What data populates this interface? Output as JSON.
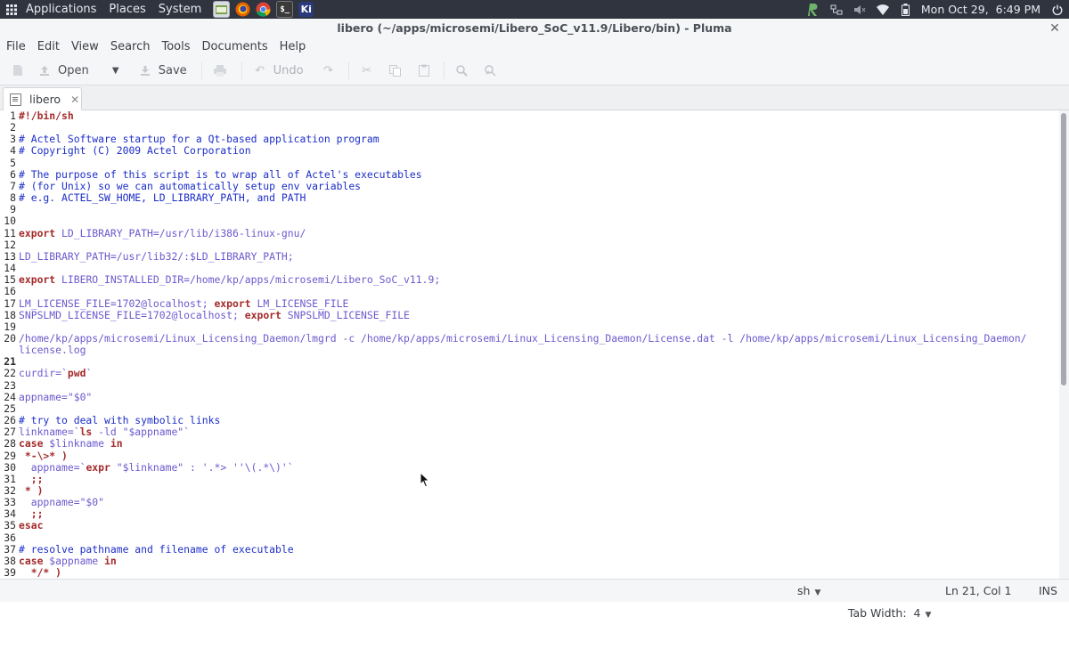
{
  "panel": {
    "menus": [
      "Applications",
      "Places",
      "System"
    ],
    "launchers": [
      "file-manager",
      "firefox",
      "chrome",
      "terminal",
      "kicad"
    ],
    "clock": "Mon Oct 29,  6:49 PM"
  },
  "window": {
    "title": "libero (~/apps/microsemi/Libero_SoC_v11.9/Libero/bin) - Pluma"
  },
  "menubar": [
    "File",
    "Edit",
    "View",
    "Search",
    "Tools",
    "Documents",
    "Help"
  ],
  "toolbar": {
    "open_label": "Open",
    "save_label": "Save",
    "undo_label": "Undo"
  },
  "tab": {
    "label": "libero"
  },
  "editor": {
    "lines": [
      {
        "n": "1",
        "text": "#!/bin/sh",
        "style": "bold"
      },
      {
        "n": "2",
        "text": "",
        "style": "plain"
      },
      {
        "n": "3",
        "text": "# Actel Software startup for a Qt-based application program",
        "style": "comment"
      },
      {
        "n": "4",
        "text": "# Copyright (C) 2009 Actel Corporation",
        "style": "comment"
      },
      {
        "n": "5",
        "text": "",
        "style": "plain"
      },
      {
        "n": "6",
        "text": "# The purpose of this script is to wrap all of Actel's executables",
        "style": "comment"
      },
      {
        "n": "7",
        "text": "# (for Unix) so we can automatically setup env variables",
        "style": "comment"
      },
      {
        "n": "8",
        "text": "# e.g. ACTEL_SW_HOME, LD_LIBRARY_PATH, and PATH",
        "style": "comment"
      },
      {
        "n": "9",
        "text": "",
        "style": "plain"
      },
      {
        "n": "10",
        "text": "",
        "style": "plain"
      },
      {
        "n": "11",
        "text": "export LD_LIBRARY_PATH=/usr/lib/i386-linux-gnu/",
        "style": "export"
      },
      {
        "n": "12",
        "text": "",
        "style": "plain"
      },
      {
        "n": "13",
        "text": "LD_LIBRARY_PATH=/usr/lib32/:$LD_LIBRARY_PATH;",
        "style": "purple"
      },
      {
        "n": "14",
        "text": "",
        "style": "plain"
      },
      {
        "n": "15",
        "text": "export LIBERO_INSTALLED_DIR=/home/kp/apps/microsemi/Libero_SoC_v11.9;",
        "style": "export"
      },
      {
        "n": "16",
        "text": "",
        "style": "plain"
      },
      {
        "n": "17",
        "text": "LM_LICENSE_FILE=1702@localhost; export LM_LICENSE_FILE",
        "style": "purple"
      },
      {
        "n": "18",
        "text": "SNPSLMD_LICENSE_FILE=1702@localhost; export SNPSLMD_LICENSE_FILE",
        "style": "purple"
      },
      {
        "n": "19",
        "text": "",
        "style": "plain"
      },
      {
        "n": "20",
        "text": "/home/kp/apps/microsemi/Linux_Licensing_Daemon/lmgrd -c /home/kp/apps/microsemi/Linux_Licensing_Daemon/License.dat -l /home/kp/apps/microsemi/Linux_Licensing_Daemon/",
        "style": "purple"
      },
      {
        "n": "",
        "text": "license.log",
        "style": "purple"
      },
      {
        "n": "21",
        "text": "",
        "style": "current"
      },
      {
        "n": "22",
        "text": "curdir=`pwd`",
        "style": "purple"
      },
      {
        "n": "23",
        "text": "",
        "style": "plain"
      },
      {
        "n": "24",
        "text": "appname=\"$0\"",
        "style": "purple"
      },
      {
        "n": "25",
        "text": "",
        "style": "plain"
      },
      {
        "n": "26",
        "text": "# try to deal with symbolic links",
        "style": "comment"
      },
      {
        "n": "27",
        "text": "linkname=`ls -ld \"$appname\"`",
        "style": "purple"
      },
      {
        "n": "28",
        "text": "case $linkname in",
        "style": "purple"
      },
      {
        "n": "29",
        "text": " *-\\>* )",
        "style": "bold"
      },
      {
        "n": "30",
        "text": "  appname=`expr \"$linkname\" : '.*> ''\\(.*\\)'`",
        "style": "purple"
      },
      {
        "n": "31",
        "text": "  ;;",
        "style": "bold"
      },
      {
        "n": "32",
        "text": " * )",
        "style": "bold"
      },
      {
        "n": "33",
        "text": "  appname=\"$0\"",
        "style": "purple"
      },
      {
        "n": "34",
        "text": "  ;;",
        "style": "bold"
      },
      {
        "n": "35",
        "text": "esac",
        "style": "bold"
      },
      {
        "n": "36",
        "text": "",
        "style": "plain"
      },
      {
        "n": "37",
        "text": "# resolve pathname and filename of executable",
        "style": "comment"
      },
      {
        "n": "38",
        "text": "case $appname in",
        "style": "purple"
      },
      {
        "n": "39",
        "text": "  */* )",
        "style": "bold"
      }
    ]
  },
  "statusbar": {
    "language": "sh",
    "tab_width": "Tab Width:  4",
    "position": "Ln 21, Col 1",
    "mode": "INS"
  }
}
